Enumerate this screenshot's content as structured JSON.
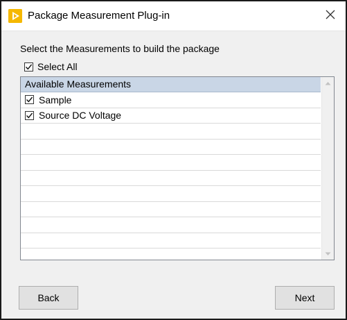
{
  "window": {
    "title": "Package Measurement Plug-in",
    "app_icon": "play-logo-icon",
    "close_icon": "close-icon"
  },
  "prompt": "Select the Measurements to build the package",
  "select_all": {
    "label": "Select All",
    "checked": true
  },
  "list": {
    "header": "Available Measurements",
    "items": [
      {
        "label": "Sample",
        "checked": true
      },
      {
        "label": "Source DC Voltage",
        "checked": true
      }
    ],
    "empty_rows": 8
  },
  "buttons": {
    "back": "Back",
    "next": "Next"
  },
  "colors": {
    "accent_icon": "#f5b800",
    "header_bg": "#c9d6e6",
    "dialog_bg": "#f0f0f0"
  }
}
